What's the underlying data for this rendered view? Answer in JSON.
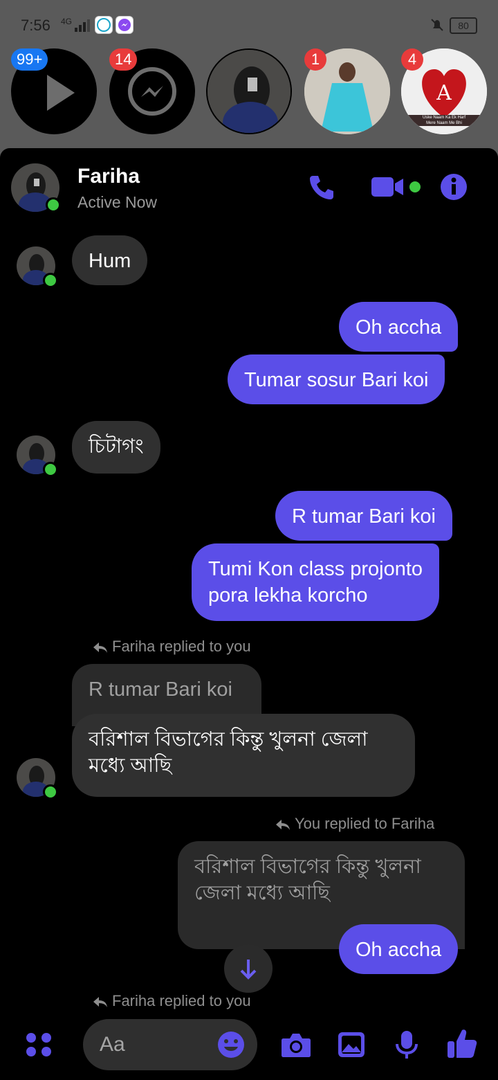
{
  "status_bar": {
    "time": "7:56",
    "network": "4G",
    "battery": "80"
  },
  "chat_heads": [
    {
      "badge": "99+"
    },
    {
      "badge": "14"
    },
    {
      "badge": ""
    },
    {
      "badge": "1"
    },
    {
      "badge": "4",
      "image_caption_1": "Uske Naam Ka Ek Harf",
      "image_caption_2": "Mere Naam Me Bhi"
    }
  ],
  "header": {
    "name": "Fariha",
    "status": "Active Now"
  },
  "messages": [
    {
      "text": "Hum"
    },
    {
      "text": "Oh accha"
    },
    {
      "text": "Tumar sosur Bari koi"
    },
    {
      "text": "চিটাগং"
    },
    {
      "text": "R tumar Bari koi"
    },
    {
      "line1": "Tumi Kon class projonto",
      "line2": "pora lekha korcho"
    },
    {
      "reply_note": "Fariha replied to you",
      "quoted": "R tumar Bari koi",
      "line1": "বরিশাল বিভাগের কিন্তু খুলনা জেলা",
      "line2": "মধ্যে আছি"
    },
    {
      "reply_note": "You replied to Fariha",
      "quoted_line1": "বরিশাল বিভাগের কিন্তু খুলনা",
      "quoted_line2": "জেলা মধ্যে আছি",
      "text": "Oh accha"
    },
    {
      "reply_note": "Fariha replied to you"
    }
  ],
  "composer": {
    "placeholder": "Aa"
  },
  "colors": {
    "accent": "#5b4ee8",
    "incoming": "#303030",
    "online": "#3ec942",
    "badge": "#e83b3b"
  }
}
